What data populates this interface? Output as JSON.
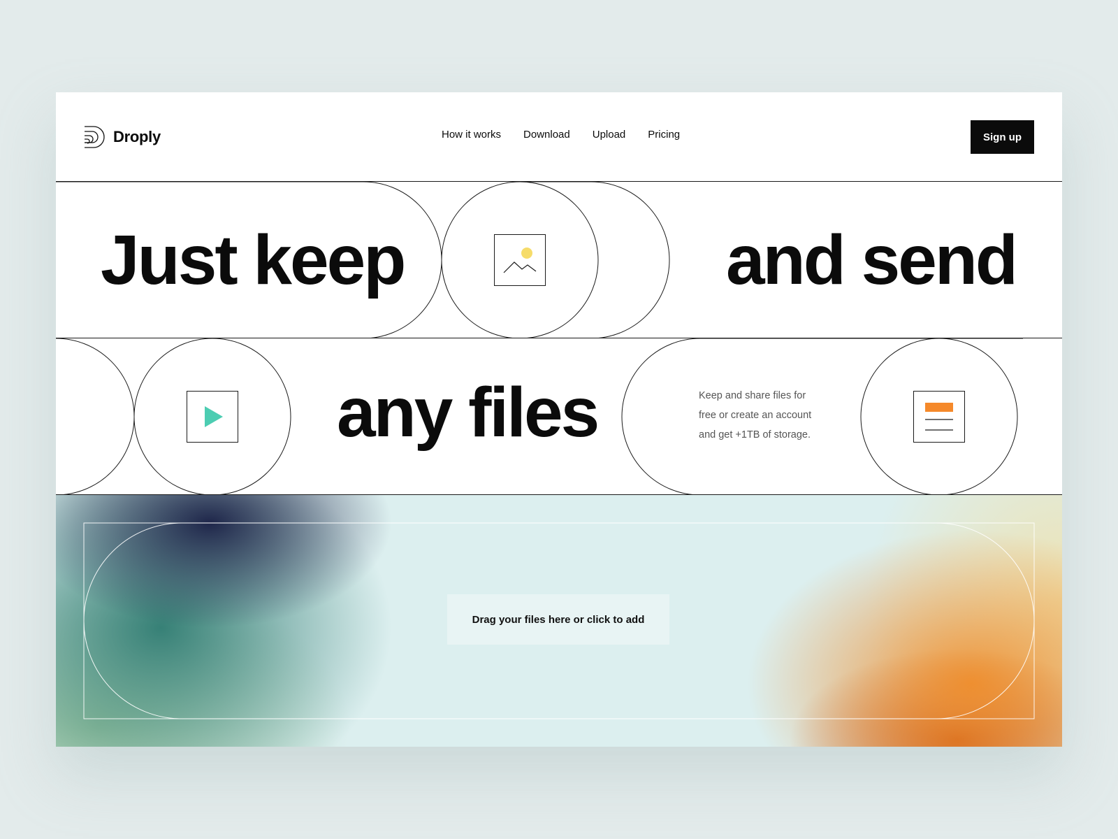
{
  "brand": {
    "name": "Droply"
  },
  "nav": {
    "items": [
      {
        "label": "How it works"
      },
      {
        "label": "Download"
      },
      {
        "label": "Upload"
      },
      {
        "label": "Pricing"
      }
    ]
  },
  "header": {
    "signup_label": "Sign up"
  },
  "hero": {
    "line1_left": "Just keep",
    "line1_right": "and send",
    "line2": "any files",
    "description": "Keep and share files for free or create an account and get +1TB of storage."
  },
  "dropzone": {
    "label": "Drag your files here or click to add"
  },
  "icons": {
    "image": "image-icon",
    "play": "play-icon",
    "document": "document-icon",
    "logo": "droply-logo-icon"
  },
  "colors": {
    "accent_dark": "#0b0b0b",
    "sun_yellow": "#f6dc6a",
    "play_teal": "#4ccdb2",
    "doc_orange": "#f5892a"
  }
}
